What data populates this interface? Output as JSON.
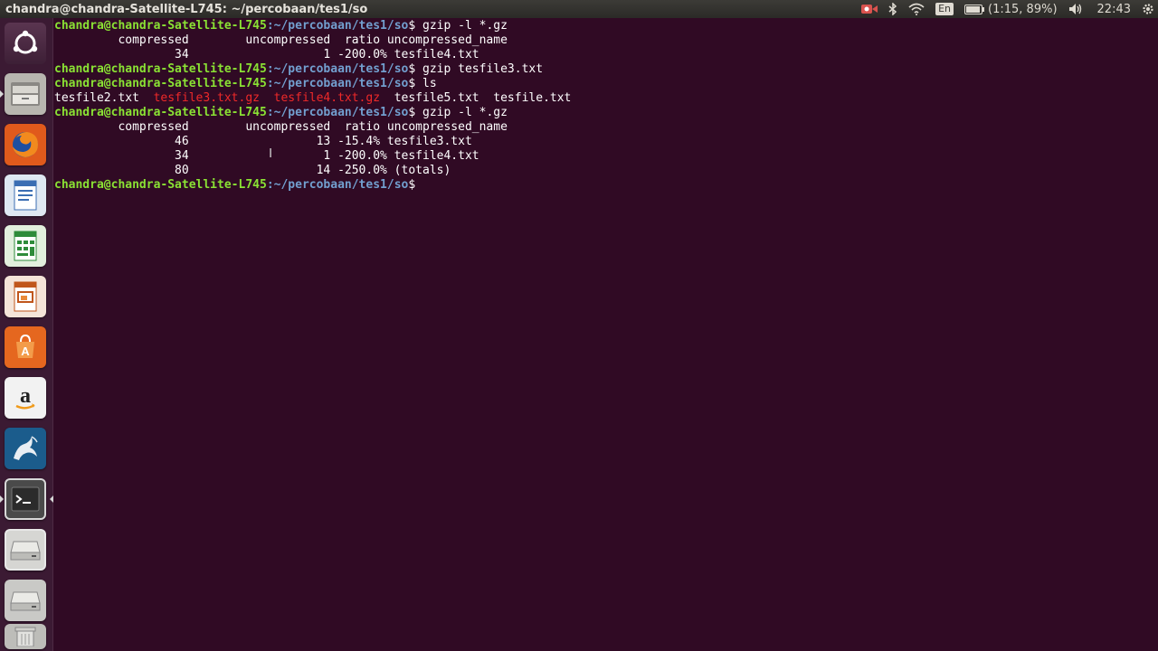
{
  "panel": {
    "window_title": "chandra@chandra-Satellite-L745: ~/percobaan/tes1/so",
    "keyboard_layout": "En",
    "battery_text": "(1:15, 89%)",
    "clock": "22:43",
    "icons": [
      "camera-record-icon",
      "bluetooth-icon",
      "wifi-icon",
      "keyboard-layout-indicator",
      "battery-icon",
      "volume-icon",
      "gear-icon"
    ]
  },
  "launcher": {
    "items": [
      "dash-home-icon",
      "files-icon",
      "firefox-icon",
      "writer-icon",
      "calc-icon",
      "impress-icon",
      "software-center-icon",
      "amazon-icon",
      "mysql-workbench-icon",
      "terminal-icon",
      "drive-icon",
      "drive-icon-2",
      "trash-icon"
    ]
  },
  "terminal": {
    "prompt_user": "chandra@chandra-Satellite-L745",
    "prompt_path": ":~/percobaan/tes1/so",
    "prompt_symbol": "$",
    "cmd1": " gzip -l *.gz",
    "out1_header": "         compressed        uncompressed  ratio uncompressed_name",
    "out1_row1": "                 34                   1 -200.0% tesfile4.txt",
    "cmd2": " gzip tesfile3.txt",
    "cmd3": " ls",
    "ls_files": {
      "f1": "tesfile2.txt",
      "f2": "tesfile3.txt.gz",
      "f3": "tesfile4.txt.gz",
      "f4": "tesfile5.txt",
      "f5": "tesfile.txt"
    },
    "cmd4": " gzip -l *.gz",
    "out2_header": "         compressed        uncompressed  ratio uncompressed_name",
    "out2_row1": "                 46                  13 -15.4% tesfile3.txt",
    "out2_row2": "                 34                   1 -200.0% tesfile4.txt",
    "out2_row3": "                 80                  14 -250.0% (totals)",
    "colors": {
      "user": "#8ae234",
      "path": "#729fcf",
      "archive": "#ef2929",
      "background": "#300a24"
    }
  }
}
